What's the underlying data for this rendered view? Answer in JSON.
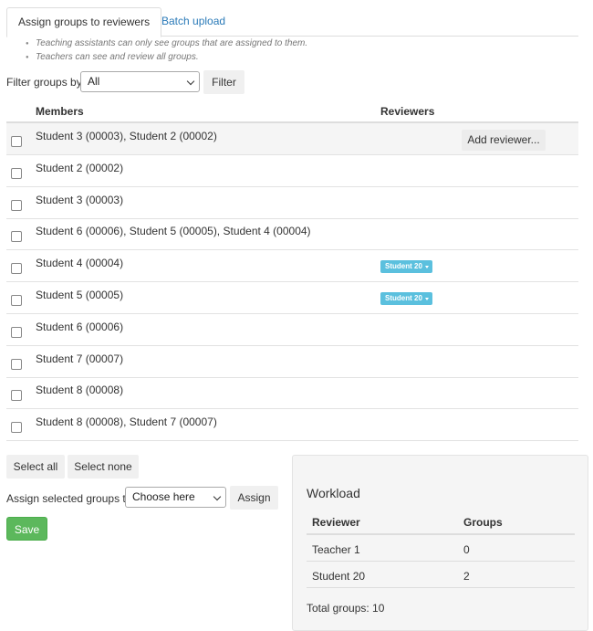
{
  "tabs": [
    {
      "label": "Assign groups to reviewers",
      "active": true
    },
    {
      "label": "Batch upload",
      "active": false
    }
  ],
  "notes": [
    "Teaching assistants can only see groups that are assigned to them.",
    "Teachers can see and review all groups."
  ],
  "filter": {
    "label": "Filter groups by",
    "selected": "All",
    "button": "Filter"
  },
  "table": {
    "headers": {
      "members": "Members",
      "reviewers": "Reviewers"
    },
    "add_reviewer_label": "Add reviewer...",
    "rows": [
      {
        "members": "Student 3 (00003), Student 2 (00002)",
        "reviewers": []
      },
      {
        "members": "Student 2 (00002)",
        "reviewers": []
      },
      {
        "members": "Student 3 (00003)",
        "reviewers": []
      },
      {
        "members": "Student 6 (00006), Student 5 (00005), Student 4 (00004)",
        "reviewers": []
      },
      {
        "members": "Student 4 (00004)",
        "reviewers": [
          "Student 20"
        ]
      },
      {
        "members": "Student 5 (00005)",
        "reviewers": [
          "Student 20"
        ]
      },
      {
        "members": "Student 6 (00006)",
        "reviewers": []
      },
      {
        "members": "Student 7 (00007)",
        "reviewers": []
      },
      {
        "members": "Student 8 (00008)",
        "reviewers": []
      },
      {
        "members": "Student 8 (00008), Student 7 (00007)",
        "reviewers": []
      }
    ]
  },
  "actions": {
    "select_all": "Select all",
    "select_none": "Select none",
    "assign_label": "Assign selected groups to",
    "assign_selected": "Choose here",
    "assign_button": "Assign",
    "save": "Save"
  },
  "workload": {
    "title": "Workload",
    "headers": {
      "reviewer": "Reviewer",
      "groups": "Groups"
    },
    "rows": [
      {
        "reviewer": "Teacher 1",
        "groups": "0"
      },
      {
        "reviewer": "Student 20",
        "groups": "2"
      }
    ],
    "total": "Total groups: 10"
  },
  "colors": {
    "link": "#2a7ab8",
    "badge": "#5bc0de",
    "save": "#5cb85c"
  }
}
